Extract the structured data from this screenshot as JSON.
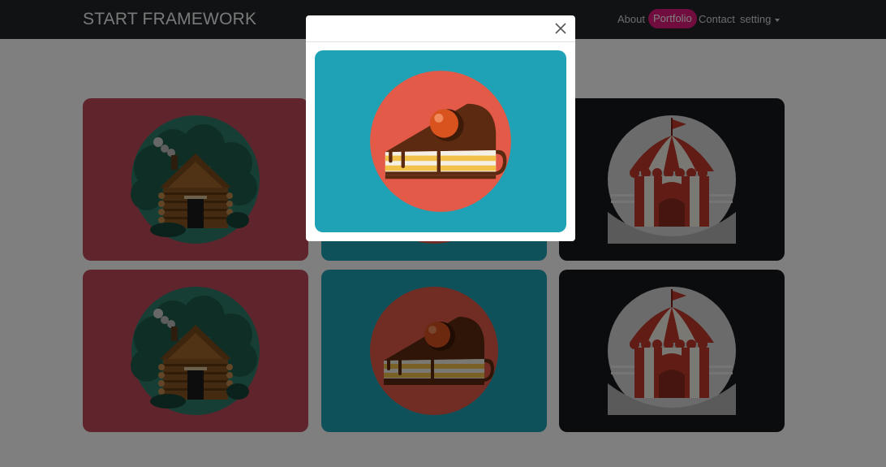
{
  "navbar": {
    "brand": "START FRAMEWORK",
    "links": [
      {
        "label": "About",
        "active": false
      },
      {
        "label": "Portfolio",
        "active": true
      },
      {
        "label": "Contact",
        "active": false
      },
      {
        "label": "setting",
        "active": false,
        "dropdown": true
      }
    ]
  },
  "portfolio": {
    "items": [
      {
        "icon": "cabin-icon",
        "background": "#c0485a"
      },
      {
        "icon": "cake-icon",
        "background": "#1fa2b5"
      },
      {
        "icon": "circus-tent-icon",
        "background": "#16181a"
      },
      {
        "icon": "cabin-icon",
        "background": "#c0485a"
      },
      {
        "icon": "cake-icon",
        "background": "#1fa2b5"
      },
      {
        "icon": "circus-tent-icon",
        "background": "#16181a"
      }
    ]
  },
  "modal": {
    "image_icon": "cake-icon",
    "image_background": "#1fa2b5",
    "close_icon": "close-icon"
  },
  "colors": {
    "navbar_bg": "#212529",
    "accent_pink": "#e2197d",
    "cabin_card": "#c0485a",
    "cake_card": "#1fa2b5",
    "tent_card": "#16181a"
  }
}
